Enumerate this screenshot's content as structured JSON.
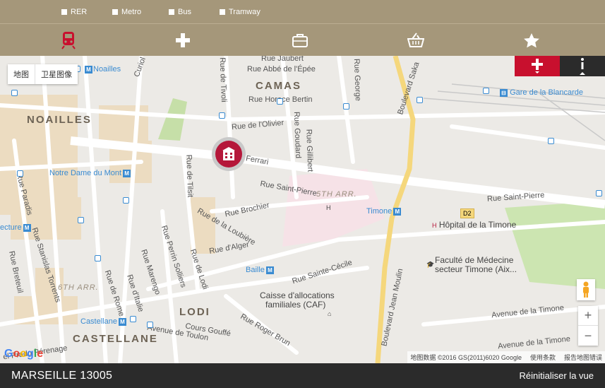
{
  "filters": [
    {
      "label": "RER"
    },
    {
      "label": "Metro"
    },
    {
      "label": "Bus"
    },
    {
      "label": "Tramway"
    }
  ],
  "categories": [
    "train-icon",
    "plus-icon",
    "briefcase-icon",
    "basket-icon",
    "star-icon"
  ],
  "map": {
    "type_options": [
      "地图",
      "卫星图像"
    ],
    "labels": {
      "noailles": "NOAILLES",
      "camas": "CAMAS",
      "lodi": "LODI",
      "castellane": "CASTELLANE",
      "arr5": "5TH ARR.",
      "arr6": "6TH ARR.",
      "noailles_stop": "Noailles",
      "notre_dame": "Notre Dame du Mont",
      "timone": "Timone",
      "baille": "Baille",
      "castellane_stop": "Castellane",
      "lecture": "ecture",
      "gare": "Gare de la Blancarde",
      "hopital": "Hôpital de la Timone",
      "faculte1": "Faculté de Médecine",
      "faculte2": "secteur Timone (Aix...",
      "caisse1": "Caisse d'allocations",
      "caisse2": "familiales (CAF)",
      "d2": "D2",
      "rue_jaubert": "Rue Jaubert",
      "rue_abbe": "Rue Abbé de l'Épée",
      "rue_horace": "Rue Horace Bertin",
      "rue_olivier": "Rue de l'Olivier",
      "ferrari": "Ferrari",
      "rue_saint_pierre": "Rue Saint-Pierre",
      "rue_saint_pierre2": "Rue Saint-Pierre",
      "rue_brochier": "Rue Brochier",
      "rue_loubiere": "Rue de la Loubière",
      "rue_alger": "Rue d'Alger",
      "rue_sainte_cecile": "Rue Sainte-Cécile",
      "rue_roger_brun": "Rue Roger Brun",
      "cours_gouffe": "Cours Gouffé",
      "avenue_toulon": "Avenue de Toulon",
      "avenue_timone": "Avenue de la Timone",
      "avenue_timone2": "Avenue de la Timone",
      "boulevard_jean_moulin": "Boulevard Jean Moulin",
      "boulevard_sakakini": "Boulevard Saka",
      "rue_paradis": "Rue Paradis",
      "rue_stanislas": "Rue Stanislas Torrents",
      "rue_breteuil": "Rue Breteuil",
      "rue_rome": "Rue de Rome",
      "rue_italie": "Rue d'Italie",
      "rue_perrin": "Rue Perrin Solliers",
      "rue_marengo": "Rue Marengo",
      "rue_lodi": "Rue de Lodi",
      "rue_tilsit": "Rue de Tilsit",
      "rue_goudard": "Rue Goudard",
      "rue_gillibert": "Rue Gillibert",
      "rue_tivoli": "Rue de Tivoli",
      "rue_george": "Rue George",
      "curiol": "Curiol",
      "prado": "el Prado Pérenage"
    },
    "attribution": [
      "地图数据 ©2016 GS(2011)6020 Google",
      "使用条款",
      "报告地图错误"
    ],
    "google_logo": "Google",
    "zoom_in": "+",
    "zoom_out": "−"
  },
  "footer": {
    "title": "MARSEILLE 13005",
    "reset": "Réinitialiser la vue"
  },
  "colors": {
    "bar": "#a5977a",
    "accent": "#c8102e",
    "marker": "#b5173a",
    "transit": "#3a8bd1",
    "footer": "#2b2b2b"
  }
}
